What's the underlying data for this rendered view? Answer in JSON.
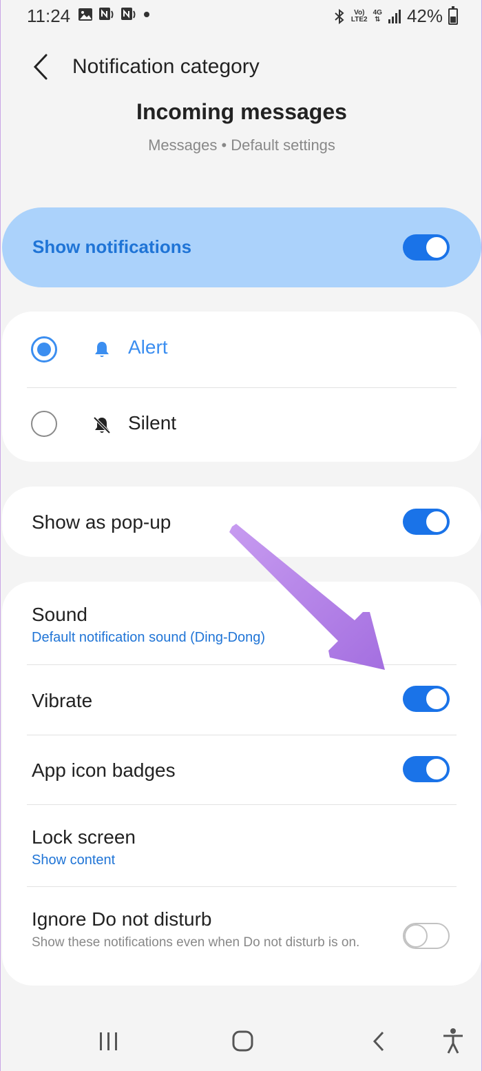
{
  "status_bar": {
    "time": "11:24",
    "volte_label": "Vo)",
    "lte_label": "LTE2",
    "network_label": "4G",
    "battery": "42%",
    "battery_level": 0.42
  },
  "header": {
    "title": "Notification category"
  },
  "category": {
    "name": "Incoming messages",
    "subtitle": "Messages • Default settings"
  },
  "show_notifications": {
    "label": "Show notifications",
    "enabled": true
  },
  "alert_mode": {
    "options": [
      {
        "label": "Alert",
        "selected": true,
        "icon": "bell-icon"
      },
      {
        "label": "Silent",
        "selected": false,
        "icon": "bell-off-icon"
      }
    ]
  },
  "popup": {
    "label": "Show as pop-up",
    "enabled": true
  },
  "settings": {
    "sound": {
      "label": "Sound",
      "value": "Default notification sound (Ding-Dong)"
    },
    "vibrate": {
      "label": "Vibrate",
      "enabled": true
    },
    "badges": {
      "label": "App icon badges",
      "enabled": true
    },
    "lock_screen": {
      "label": "Lock screen",
      "value": "Show content"
    },
    "dnd": {
      "label": "Ignore Do not disturb",
      "description": "Show these notifications even when Do not disturb is on.",
      "enabled": false
    }
  },
  "nav_bar": {
    "icons": [
      "recents-icon",
      "home-icon",
      "back-icon",
      "accessibility-icon"
    ]
  },
  "colors": {
    "accent": "#1a73e8",
    "highlight_card": "#abd2fb",
    "annotation_arrow": "#b57ee6",
    "background": "#f4f4f4"
  }
}
